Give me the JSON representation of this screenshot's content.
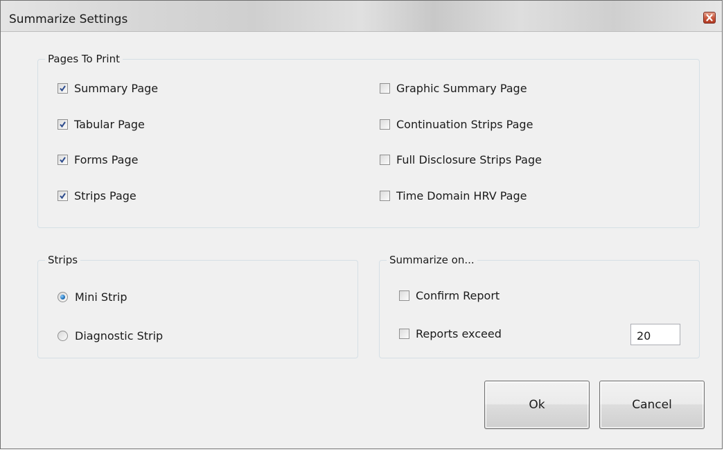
{
  "window": {
    "title": "Summarize Settings"
  },
  "pages_group": {
    "legend": "Pages To Print",
    "left_items": [
      {
        "label": "Summary Page",
        "checked": true
      },
      {
        "label": "Tabular Page",
        "checked": true
      },
      {
        "label": "Forms Page",
        "checked": true
      },
      {
        "label": "Strips Page",
        "checked": true
      }
    ],
    "right_items": [
      {
        "label": "Graphic Summary Page",
        "checked": false
      },
      {
        "label": "Continuation Strips Page",
        "checked": false
      },
      {
        "label": "Full Disclosure Strips Page",
        "checked": false
      },
      {
        "label": "Time Domain HRV Page",
        "checked": false
      }
    ]
  },
  "strips_group": {
    "legend": "Strips",
    "options": [
      {
        "label": "Mini Strip",
        "selected": true
      },
      {
        "label": "Diagnostic Strip",
        "selected": false
      }
    ]
  },
  "summarize_group": {
    "legend": "Summarize on...",
    "confirm_report": {
      "label": "Confirm Report",
      "checked": false
    },
    "reports_exceed": {
      "label": "Reports exceed",
      "checked": false,
      "value": "20"
    }
  },
  "buttons": {
    "ok": "Ok",
    "cancel": "Cancel"
  },
  "colors": {
    "check_mark": "#2b4a8c",
    "radio_selected": "#1f6fb8",
    "close_button": "#c7543a"
  },
  "icons": {
    "close": "close-x-icon",
    "check": "checkmark-icon",
    "radio": "radio-dot-icon"
  }
}
